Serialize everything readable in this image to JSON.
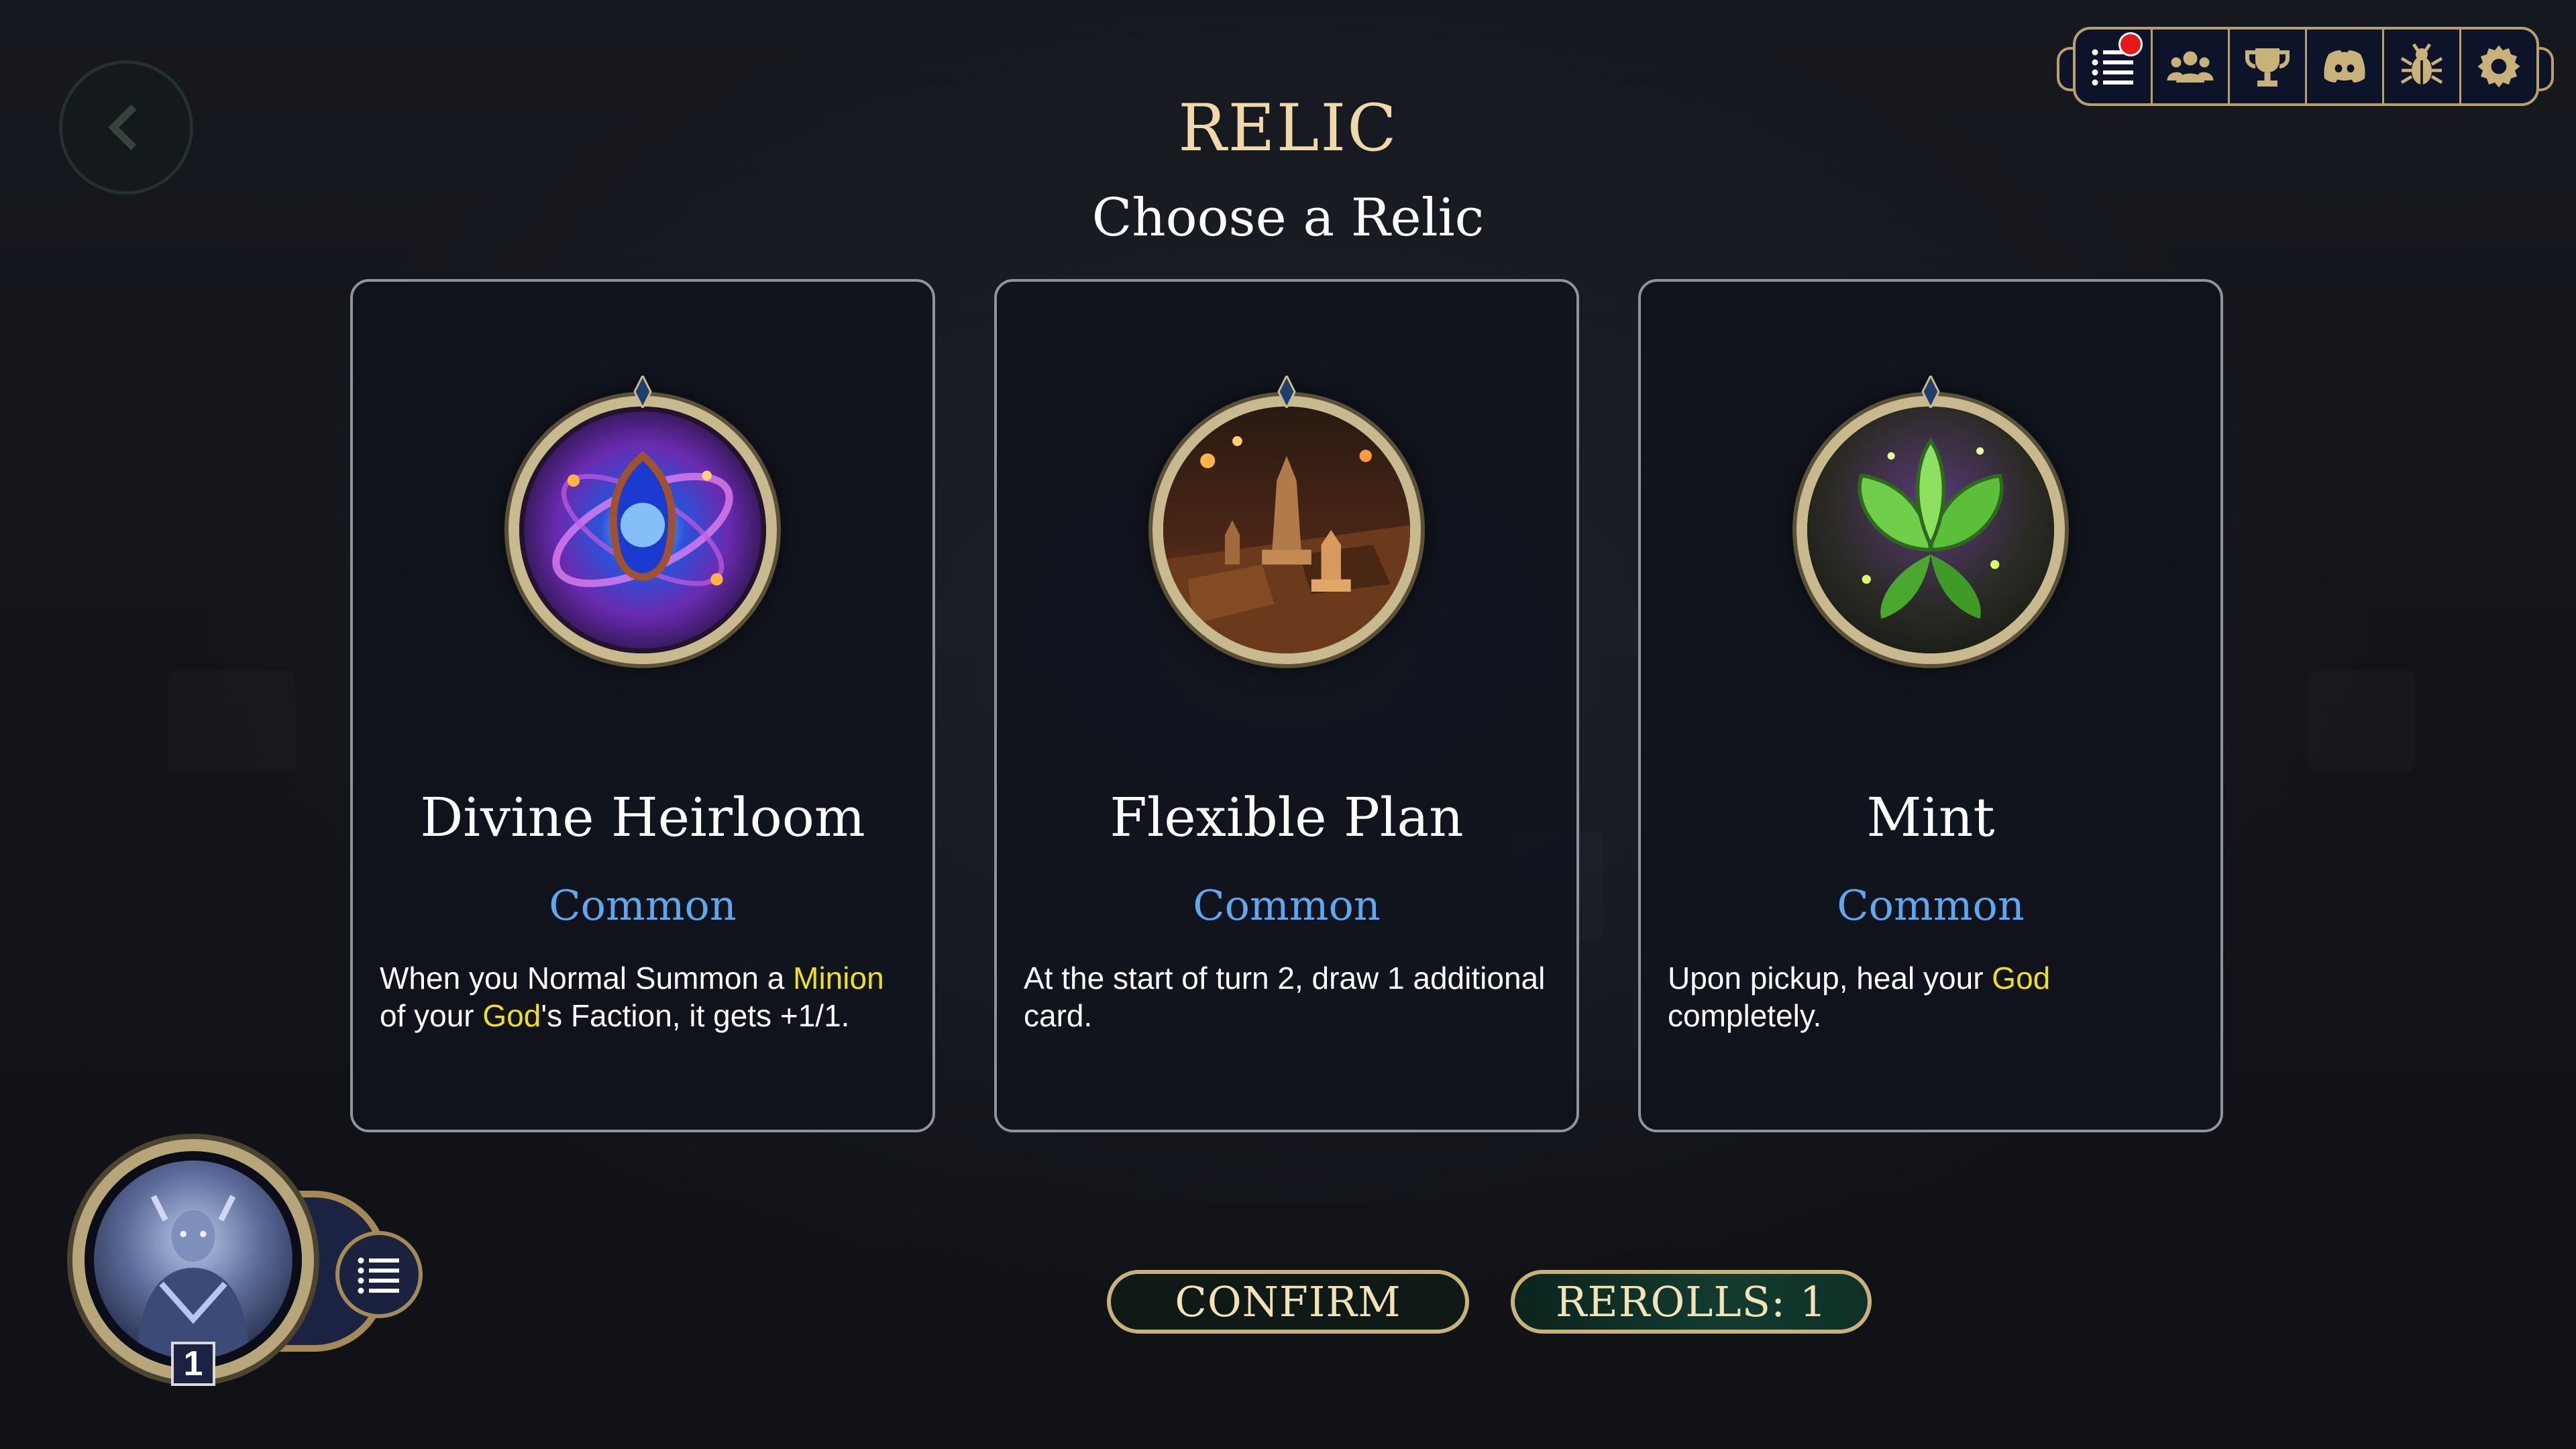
{
  "header": {
    "title": "RELIC",
    "subtitle": "Choose a Relic"
  },
  "cards": [
    {
      "name": "Divine Heirloom",
      "rarity": "Common",
      "description": [
        {
          "text": "When you Normal Summon a "
        },
        {
          "text": "Minion",
          "keyword": true
        },
        {
          "text": " of your "
        },
        {
          "text": "God",
          "keyword": true
        },
        {
          "text": "'s Faction, it gets +1/1."
        }
      ],
      "image": "swirling-cosmic-amulet"
    },
    {
      "name": "Flexible Plan",
      "rarity": "Common",
      "description": [
        {
          "text": "At the start of turn 2, draw 1 additional card."
        }
      ],
      "image": "chess-pieces-on-board"
    },
    {
      "name": "Mint",
      "rarity": "Common",
      "description": [
        {
          "text": "Upon pickup, heal your "
        },
        {
          "text": "God",
          "keyword": true
        },
        {
          "text": " completely."
        }
      ],
      "image": "glowing-mint-plant"
    }
  ],
  "buttons": {
    "confirm": "CONFIRM",
    "rerolls": "REROLLS: 1"
  },
  "player": {
    "level": "1",
    "portrait": "armored-god-portrait"
  },
  "topbar": {
    "icons": [
      "list-icon",
      "friends-icon",
      "trophy-icon",
      "discord-icon",
      "bug-icon",
      "gear-icon"
    ],
    "notification_on": "list-icon"
  },
  "colors": {
    "gold": "#c8b27a",
    "title": "#f0d9a8",
    "rarity_common": "#5fa8f0",
    "keyword": "#f0e01a",
    "notification": "#e81818"
  }
}
